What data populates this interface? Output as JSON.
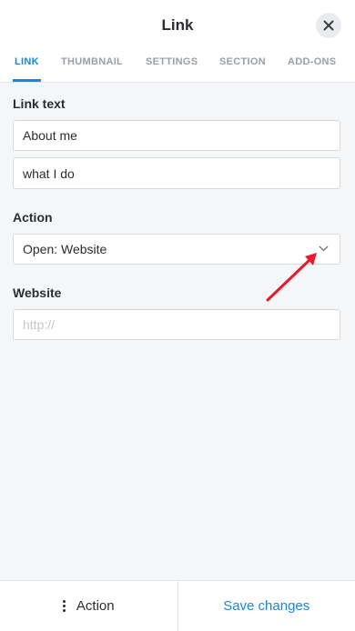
{
  "header": {
    "title": "Link",
    "close_icon": "close-icon"
  },
  "tabs": [
    {
      "label": "LINK",
      "active": true
    },
    {
      "label": "THUMBNAIL",
      "active": false
    },
    {
      "label": "SETTINGS",
      "active": false
    },
    {
      "label": "SECTION",
      "active": false
    },
    {
      "label": "ADD-ONS",
      "active": false
    }
  ],
  "form": {
    "link_text": {
      "label": "Link text",
      "line1": "About me",
      "line2": "what I do"
    },
    "action": {
      "label": "Action",
      "selected": "Open: Website",
      "icon": "chevron-down-icon"
    },
    "website": {
      "label": "Website",
      "value": "",
      "placeholder": "http://"
    }
  },
  "annotation": {
    "icon": "red-arrow-icon",
    "color": "#e8192c"
  },
  "footer": {
    "action_label": "Action",
    "action_icon": "vertical-dots-icon",
    "save_label": "Save changes"
  },
  "colors": {
    "accent": "#1a86d6",
    "background": "#f5f6f7"
  }
}
